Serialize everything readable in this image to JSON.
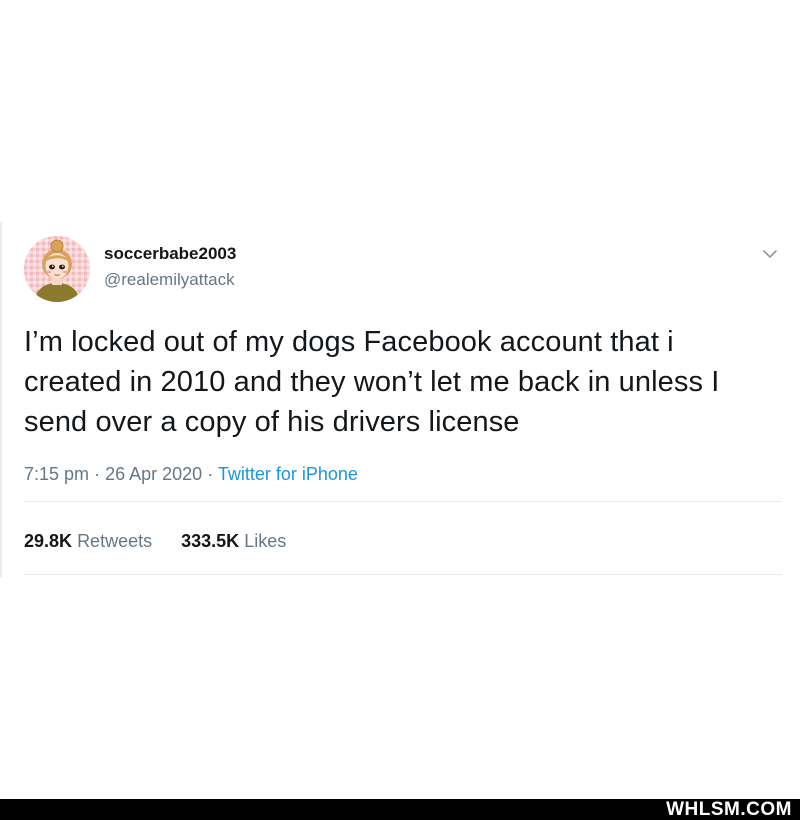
{
  "tweet": {
    "author": {
      "display_name": "soccerbabe2003",
      "handle": "@realemilyattack",
      "avatar_icon": "cartoon-girl-avatar"
    },
    "menu_icon": "chevron-down-icon",
    "text": "I’m locked out of my dogs Facebook account that i created in 2010 and they won’t let me back in unless I send over a copy of his drivers license",
    "time": "7:15 pm",
    "separator": "·",
    "date": "26 Apr 2020",
    "source": "Twitter for iPhone",
    "retweets": {
      "count": "29.8K",
      "label": "Retweets"
    },
    "likes": {
      "count": "333.5K",
      "label": "Likes"
    }
  },
  "colors": {
    "text_primary": "#14171a",
    "text_secondary": "#657786",
    "link": "#1b95e0",
    "divider": "#e6ecf0",
    "watermark_bar": "#000000"
  },
  "watermark": {
    "text": "WHLSM.COM"
  }
}
